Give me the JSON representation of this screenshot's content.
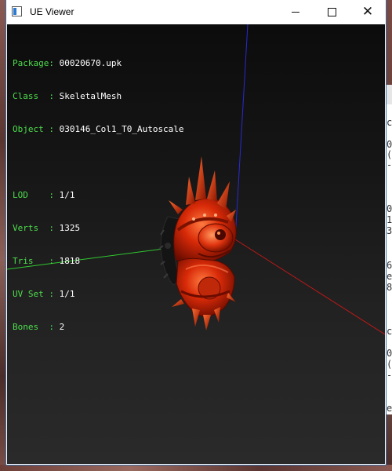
{
  "window": {
    "title": "UE Viewer"
  },
  "controls": {
    "minimize": "minimize",
    "maximize": "maximize",
    "close": "✕"
  },
  "info": {
    "package_label": "Package: ",
    "package_value": "00020670.upk",
    "class_label": "Class  : ",
    "class_value": "SkeletalMesh",
    "object_label": "Object : ",
    "object_value": "030146_Col1_T0_Autoscale",
    "lod_label": "LOD    : ",
    "lod_value": "1/1",
    "verts_label": "Verts  : ",
    "verts_value": "1325",
    "tris_label": "Tris   : ",
    "tris_value": "1818",
    "uvset_label": "UV Set : ",
    "uvset_value": "1/1",
    "bones_label": "Bones  : ",
    "bones_value": "2"
  },
  "side_panel": {
    "fragments": [
      "c",
      "0",
      "(",
      "-",
      "0",
      "1",
      "3",
      "6",
      "e",
      "8",
      "c",
      "0",
      "(",
      "-",
      "e"
    ]
  },
  "colors": {
    "label_green": "#4dde4d",
    "value_white": "#ffffff",
    "axis_x": "#c01818",
    "axis_y": "#2a2ad0",
    "axis_z": "#30c830",
    "mesh_red": "#d82a08"
  }
}
